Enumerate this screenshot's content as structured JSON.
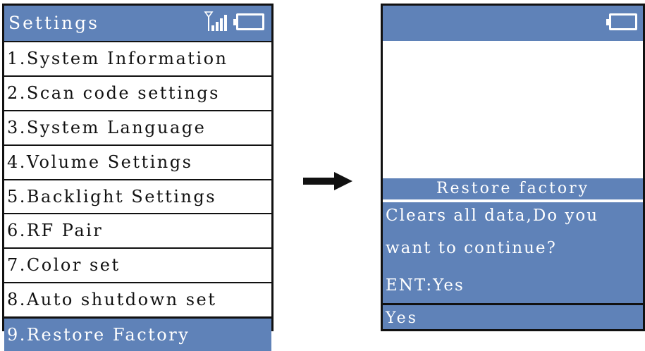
{
  "settings_screen": {
    "title": "Settings",
    "status_icons": [
      "signal-icon",
      "battery-icon"
    ],
    "menu_items": [
      "1.System Information",
      "2.Scan code settings",
      "3.System Language",
      "4.Volume Settings",
      "5.Backlight Settings",
      "6.RF Pair",
      "7.Color set",
      "8.Auto shutdown set",
      "9.Restore Factory"
    ],
    "selected_index": 8
  },
  "restore_screen": {
    "status_icons": [
      "battery-icon"
    ],
    "dialog_title": "Restore factory",
    "dialog_lines": [
      "Clears all data,Do you",
      "want to continue?",
      "ENT:Yes"
    ],
    "softkey_label": "Yes"
  },
  "colors": {
    "accent": "#5f82b8",
    "border": "#111111",
    "text_on_accent": "#ffffff"
  }
}
